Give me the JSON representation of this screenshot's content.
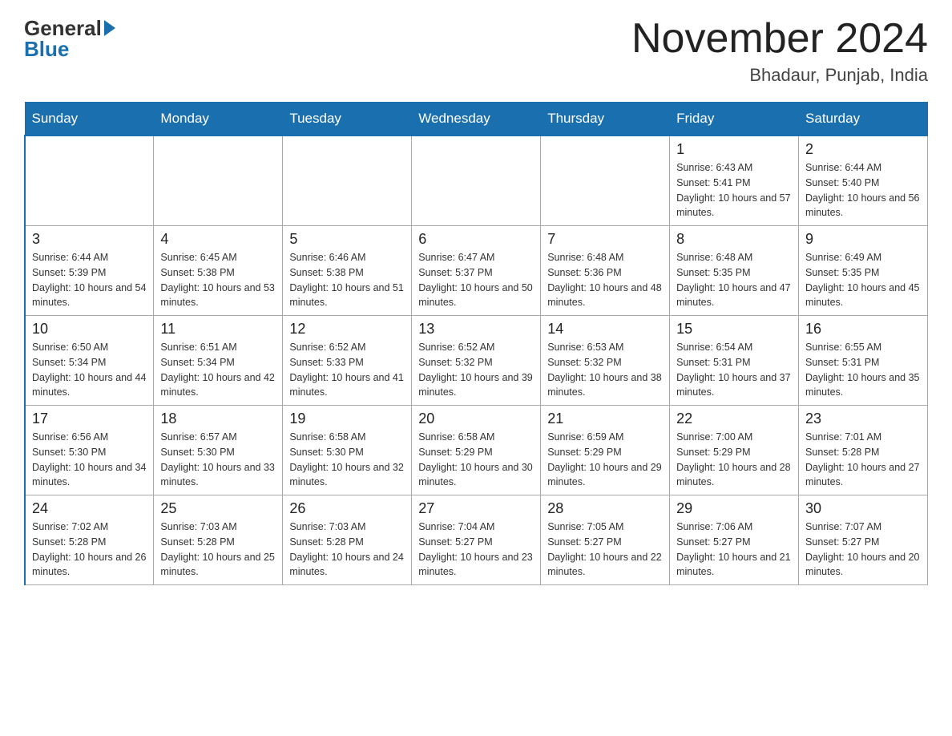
{
  "header": {
    "logo_general": "General",
    "logo_blue": "Blue",
    "title": "November 2024",
    "subtitle": "Bhadaur, Punjab, India"
  },
  "weekdays": [
    "Sunday",
    "Monday",
    "Tuesday",
    "Wednesday",
    "Thursday",
    "Friday",
    "Saturday"
  ],
  "rows": [
    [
      {
        "day": "",
        "info": ""
      },
      {
        "day": "",
        "info": ""
      },
      {
        "day": "",
        "info": ""
      },
      {
        "day": "",
        "info": ""
      },
      {
        "day": "",
        "info": ""
      },
      {
        "day": "1",
        "info": "Sunrise: 6:43 AM\nSunset: 5:41 PM\nDaylight: 10 hours and 57 minutes."
      },
      {
        "day": "2",
        "info": "Sunrise: 6:44 AM\nSunset: 5:40 PM\nDaylight: 10 hours and 56 minutes."
      }
    ],
    [
      {
        "day": "3",
        "info": "Sunrise: 6:44 AM\nSunset: 5:39 PM\nDaylight: 10 hours and 54 minutes."
      },
      {
        "day": "4",
        "info": "Sunrise: 6:45 AM\nSunset: 5:38 PM\nDaylight: 10 hours and 53 minutes."
      },
      {
        "day": "5",
        "info": "Sunrise: 6:46 AM\nSunset: 5:38 PM\nDaylight: 10 hours and 51 minutes."
      },
      {
        "day": "6",
        "info": "Sunrise: 6:47 AM\nSunset: 5:37 PM\nDaylight: 10 hours and 50 minutes."
      },
      {
        "day": "7",
        "info": "Sunrise: 6:48 AM\nSunset: 5:36 PM\nDaylight: 10 hours and 48 minutes."
      },
      {
        "day": "8",
        "info": "Sunrise: 6:48 AM\nSunset: 5:35 PM\nDaylight: 10 hours and 47 minutes."
      },
      {
        "day": "9",
        "info": "Sunrise: 6:49 AM\nSunset: 5:35 PM\nDaylight: 10 hours and 45 minutes."
      }
    ],
    [
      {
        "day": "10",
        "info": "Sunrise: 6:50 AM\nSunset: 5:34 PM\nDaylight: 10 hours and 44 minutes."
      },
      {
        "day": "11",
        "info": "Sunrise: 6:51 AM\nSunset: 5:34 PM\nDaylight: 10 hours and 42 minutes."
      },
      {
        "day": "12",
        "info": "Sunrise: 6:52 AM\nSunset: 5:33 PM\nDaylight: 10 hours and 41 minutes."
      },
      {
        "day": "13",
        "info": "Sunrise: 6:52 AM\nSunset: 5:32 PM\nDaylight: 10 hours and 39 minutes."
      },
      {
        "day": "14",
        "info": "Sunrise: 6:53 AM\nSunset: 5:32 PM\nDaylight: 10 hours and 38 minutes."
      },
      {
        "day": "15",
        "info": "Sunrise: 6:54 AM\nSunset: 5:31 PM\nDaylight: 10 hours and 37 minutes."
      },
      {
        "day": "16",
        "info": "Sunrise: 6:55 AM\nSunset: 5:31 PM\nDaylight: 10 hours and 35 minutes."
      }
    ],
    [
      {
        "day": "17",
        "info": "Sunrise: 6:56 AM\nSunset: 5:30 PM\nDaylight: 10 hours and 34 minutes."
      },
      {
        "day": "18",
        "info": "Sunrise: 6:57 AM\nSunset: 5:30 PM\nDaylight: 10 hours and 33 minutes."
      },
      {
        "day": "19",
        "info": "Sunrise: 6:58 AM\nSunset: 5:30 PM\nDaylight: 10 hours and 32 minutes."
      },
      {
        "day": "20",
        "info": "Sunrise: 6:58 AM\nSunset: 5:29 PM\nDaylight: 10 hours and 30 minutes."
      },
      {
        "day": "21",
        "info": "Sunrise: 6:59 AM\nSunset: 5:29 PM\nDaylight: 10 hours and 29 minutes."
      },
      {
        "day": "22",
        "info": "Sunrise: 7:00 AM\nSunset: 5:29 PM\nDaylight: 10 hours and 28 minutes."
      },
      {
        "day": "23",
        "info": "Sunrise: 7:01 AM\nSunset: 5:28 PM\nDaylight: 10 hours and 27 minutes."
      }
    ],
    [
      {
        "day": "24",
        "info": "Sunrise: 7:02 AM\nSunset: 5:28 PM\nDaylight: 10 hours and 26 minutes."
      },
      {
        "day": "25",
        "info": "Sunrise: 7:03 AM\nSunset: 5:28 PM\nDaylight: 10 hours and 25 minutes."
      },
      {
        "day": "26",
        "info": "Sunrise: 7:03 AM\nSunset: 5:28 PM\nDaylight: 10 hours and 24 minutes."
      },
      {
        "day": "27",
        "info": "Sunrise: 7:04 AM\nSunset: 5:27 PM\nDaylight: 10 hours and 23 minutes."
      },
      {
        "day": "28",
        "info": "Sunrise: 7:05 AM\nSunset: 5:27 PM\nDaylight: 10 hours and 22 minutes."
      },
      {
        "day": "29",
        "info": "Sunrise: 7:06 AM\nSunset: 5:27 PM\nDaylight: 10 hours and 21 minutes."
      },
      {
        "day": "30",
        "info": "Sunrise: 7:07 AM\nSunset: 5:27 PM\nDaylight: 10 hours and 20 minutes."
      }
    ]
  ]
}
